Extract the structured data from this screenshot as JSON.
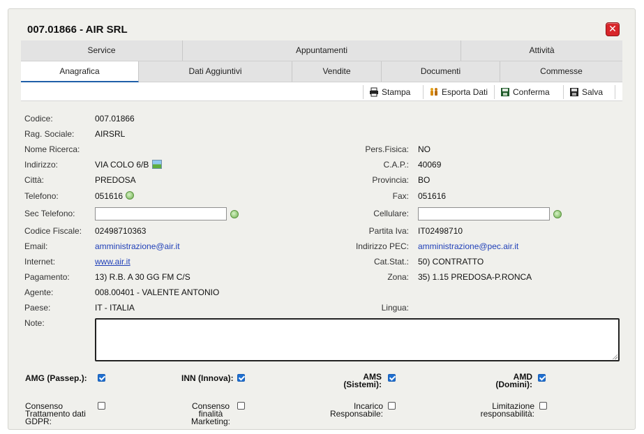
{
  "dialog": {
    "title": "007.01866 - AIR SRL",
    "close_label": "✕"
  },
  "tabs_top": [
    "Service",
    "Appuntamenti",
    "Attività"
  ],
  "tabs_bottom": [
    "Anagrafica",
    "Dati Aggiuntivi",
    "Vendite",
    "Documenti",
    "Commesse"
  ],
  "toolbar": {
    "stampa": "Stampa",
    "esporta": "Esporta Dati",
    "conferma": "Conferma",
    "salva": "Salva"
  },
  "labels": {
    "codice": "Codice:",
    "rag_sociale": "Rag. Sociale:",
    "nome_ricerca": "Nome Ricerca:",
    "indirizzo": "Indirizzo:",
    "citta": "Città:",
    "telefono": "Telefono:",
    "sec_telefono": "Sec Telefono:",
    "codice_fiscale": "Codice Fiscale:",
    "email": "Email:",
    "internet": "Internet:",
    "pagamento": "Pagamento:",
    "agente": "Agente:",
    "paese": "Paese:",
    "note": "Note:",
    "pers_fisica": "Pers.Fisica:",
    "cap": "C.A.P.:",
    "provincia": "Provincia:",
    "fax": "Fax:",
    "cellulare": "Cellulare:",
    "partita_iva": "Partita Iva:",
    "indirizzo_pec": "Indirizzo PEC:",
    "cat_stat": "Cat.Stat.:",
    "zona": "Zona:",
    "lingua": "Lingua:"
  },
  "values": {
    "codice": "007.01866",
    "rag_sociale": "AIRSRL",
    "indirizzo": "VIA COLO 6/B",
    "citta": "PREDOSA",
    "telefono": "051616",
    "codice_fiscale": "02498710363",
    "email": "amministrazione@air.it",
    "internet": "www.air.it",
    "pagamento": "13) R.B. A 30 GG FM C/S",
    "agente": "008.00401 - VALENTE ANTONIO",
    "paese": "IT - ITALIA",
    "pers_fisica": "NO",
    "cap": "40069",
    "provincia": "BO",
    "fax": "051616",
    "partita_iva": "IT02498710",
    "indirizzo_pec": "amministrazione@pec.air.it",
    "cat_stat": "50) CONTRATTO",
    "zona": "35) 1.15 PREDOSA-P.RONCA"
  },
  "inputs": {
    "sec_telefono": "",
    "cellulare": "",
    "note": ""
  },
  "flags": {
    "amg": {
      "l1": "AMG (Passep.):",
      "checked": true
    },
    "inn": {
      "l1": "INN (Innova):",
      "checked": true
    },
    "ams": {
      "l1": "AMS",
      "l2": "(Sistemi):",
      "checked": true
    },
    "amd": {
      "l1": "AMD",
      "l2": "(Domini):",
      "checked": true
    },
    "consenso_gdpr": {
      "l1": "Consenso",
      "l2": "Trattamento dati",
      "l3": "GDPR:",
      "checked": false
    },
    "consenso_mkt": {
      "l1": "Consenso",
      "l2": "finalità",
      "l3": "Marketing:",
      "checked": false
    },
    "incarico": {
      "l1": "Incarico",
      "l2": "Responsabile:",
      "checked": false
    },
    "limitazione": {
      "l1": "Limitazione",
      "l2": "responsabilità:",
      "checked": false
    }
  },
  "colors": {
    "accent": "#1f5fa8",
    "close": "#d8262a",
    "link": "#1f3fb8",
    "checkbox": "#1f6fd0"
  }
}
